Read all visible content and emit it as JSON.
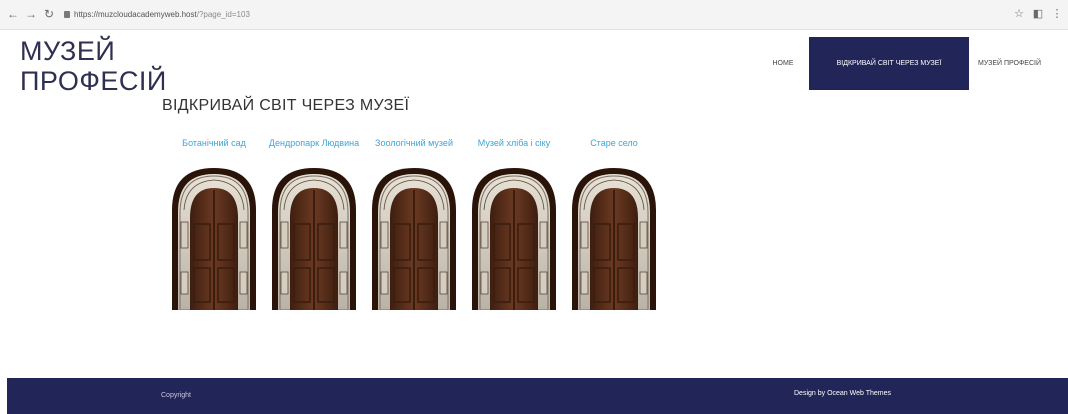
{
  "browser": {
    "url": "https://muzcloudacademyweb.host/?page_id=103",
    "url_host": "https://muzcloudacademyweb.host",
    "url_path": "/?page_id=103",
    "back_icon": "←",
    "forward_icon": "→",
    "reload_icon": "↻",
    "star_icon": "☆",
    "ext_icon": "◧",
    "menu_icon": "⋮"
  },
  "header": {
    "site_title_line1": "МУЗЕЙ",
    "site_title_line2": "ПРОФЕСІЙ"
  },
  "nav": {
    "items": [
      {
        "label": "HOME"
      },
      {
        "label": "ВІДКРИВАЙ СВІТ ЧЕРЕЗ МУЗЕЇ"
      },
      {
        "label": "МУЗЕЙ ПРОФЕСІЙ"
      }
    ],
    "active_color": "#222558"
  },
  "main": {
    "heading": "ВІДКРИВАЙ СВІТ ЧЕРЕЗ МУЗЕЇ",
    "museums": [
      {
        "label": "Ботанічний сад"
      },
      {
        "label": "Дендропарк Людвина"
      },
      {
        "label": "Зоологічний музей"
      },
      {
        "label": "Музей хліба і сіку"
      },
      {
        "label": "Старе село"
      }
    ],
    "link_color": "#3aa6d8"
  },
  "footer": {
    "copyright": "Copyright",
    "design_credit": "Design by Ocean Web Themes",
    "background": "#222558"
  }
}
